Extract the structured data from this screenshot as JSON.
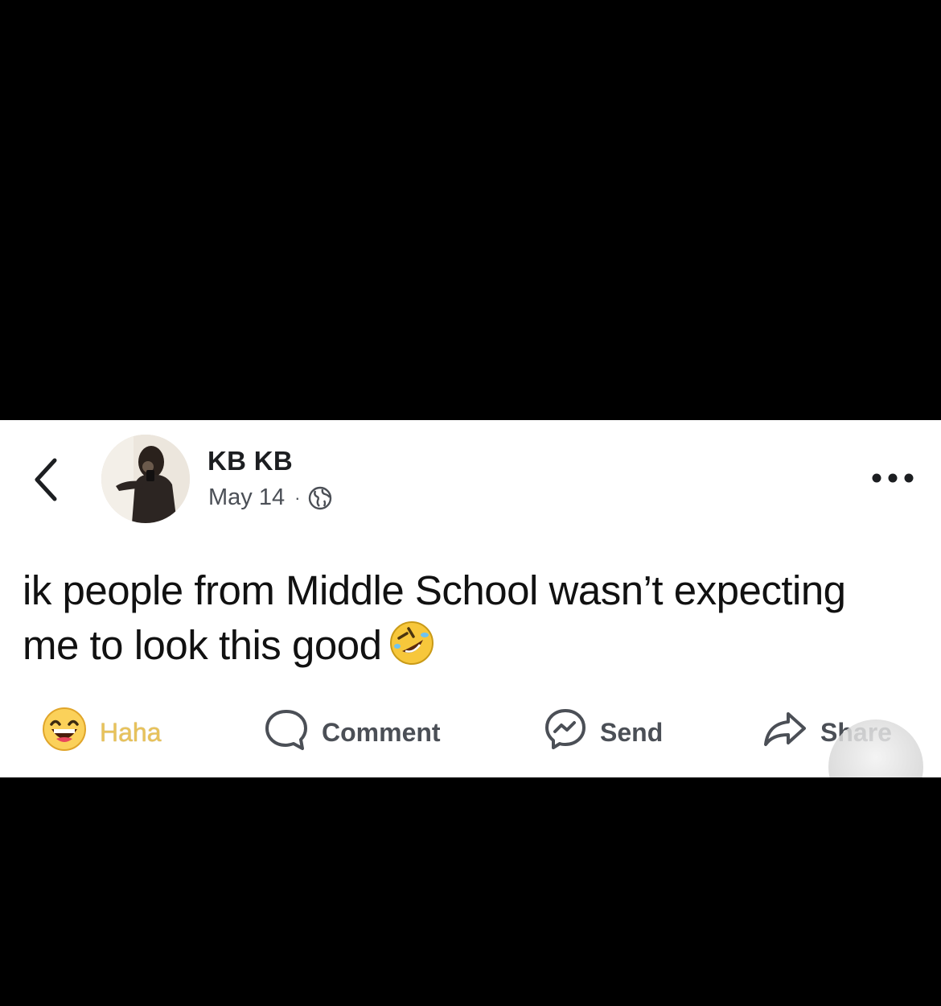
{
  "post": {
    "author_name": "KB KB",
    "date": "May 14",
    "separator": "·",
    "privacy_icon": "globe-icon",
    "text": "ik people from Middle School wasn’t expecting me to look this good",
    "text_emoji": "rolling-on-floor-laughing-emoji"
  },
  "actions": {
    "haha_label": "Haha",
    "comment_label": "Comment",
    "send_label": "Send",
    "share_label": "Share"
  },
  "icons": {
    "back": "chevron-left-icon",
    "more": "more-dots-icon",
    "haha": "haha-reaction-icon",
    "comment": "comment-bubble-icon",
    "send": "messenger-icon",
    "share": "share-arrow-icon"
  },
  "colors": {
    "background": "#000000",
    "card": "#ffffff",
    "text": "#1c1e21",
    "secondary_text": "#4b4f56",
    "haha_label": "#e8c25a"
  }
}
